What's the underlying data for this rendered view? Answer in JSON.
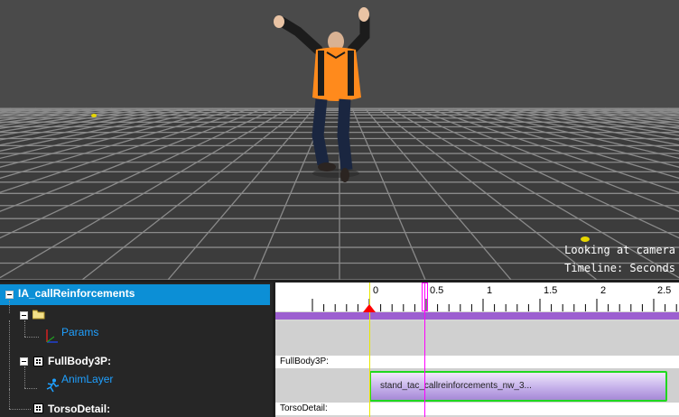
{
  "viewport": {
    "status_line1": "Looking at camera",
    "status_line2": "Timeline: Seconds"
  },
  "tree": {
    "root_label": "IA_callReinforcements",
    "folder_label": "",
    "params_label": "Params",
    "fullbody_label": "FullBody3P:",
    "animlayer_label": "AnimLayer",
    "torso_label": "TorsoDetail:"
  },
  "timeline": {
    "tick_labels": [
      "0",
      "0.5",
      "1",
      "1.5",
      "2",
      "2.5"
    ],
    "track1_label": "FullBody3P:",
    "track2_label": "TorsoDetail:",
    "clip_label": "stand_tac_callreinforcements_nw_3..."
  },
  "colors": {
    "selection": "#0c8fd6",
    "clip_border": "#1fd81f",
    "playhead": "#ff00ff",
    "zero_marker": "#e8e800",
    "anim_bar": "#9c5fd0",
    "keyframe": "#ff0000"
  }
}
